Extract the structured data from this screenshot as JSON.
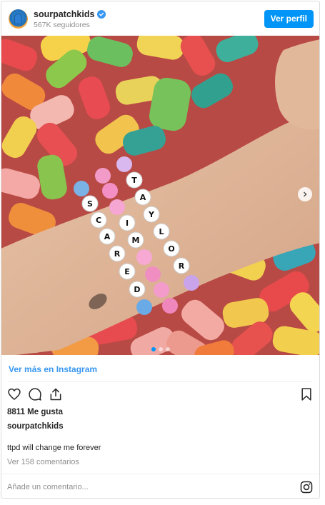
{
  "header": {
    "username": "sourpatchkids",
    "followers": "567K seguidores",
    "profile_button": "Ver perfil",
    "verified_icon": "verified-badge-icon",
    "accent_color": "#0095f6"
  },
  "photo": {
    "description_icon": "post-photo",
    "bracelet_1_letters": [
      "S",
      "C",
      "A",
      "R",
      "E",
      "D"
    ],
    "bracelet_2_letters": [
      "I",
      "M"
    ],
    "bracelet_3_letters": [
      "T",
      "A",
      "Y",
      "L",
      "O",
      "R"
    ],
    "carousel_total": 3,
    "carousel_active": 1
  },
  "footer": {
    "view_more": "Ver más en Instagram",
    "likes": "8811 Me gusta",
    "poster": "sourpatchkids",
    "caption": "ttpd will change me forever",
    "comments": "Ver 158 comentarios",
    "comment_placeholder": "Añade un comentario...",
    "icons": [
      "heart-icon",
      "comment-icon",
      "share-icon",
      "bookmark-icon",
      "instagram-icon"
    ]
  }
}
